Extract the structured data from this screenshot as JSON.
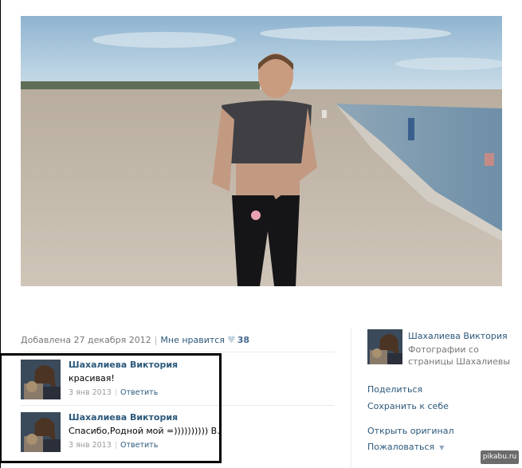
{
  "photo": {
    "description_icon": "photo"
  },
  "meta": {
    "added": "Добавлена 27 декабря 2012",
    "like_label": "Мне нравится",
    "like_icon": "heart-icon",
    "like_count": "38"
  },
  "comments": [
    {
      "author": "Шахалиева Виктория",
      "text": "красивая!",
      "date": "3 янв 2013",
      "reply": "Ответить"
    },
    {
      "author": "Шахалиева Виктория",
      "text": "Спасибо,Родной мой =)))))))))) В.",
      "date": "3 янв 2013",
      "reply": "Ответить"
    }
  ],
  "sidebar": {
    "owner_name": "Шахалиева Виктория",
    "album_line1": "Фотографии со",
    "album_line2": "страницы Шахалиевы",
    "share": "Поделиться",
    "save": "Сохранить к себе",
    "open_original": "Открыть оригинал",
    "report": "Пожаловаться"
  },
  "watermark": "pikabu.ru",
  "colors": {
    "link": "#2b587a",
    "muted": "#777777",
    "divider": "#e7ebef"
  }
}
